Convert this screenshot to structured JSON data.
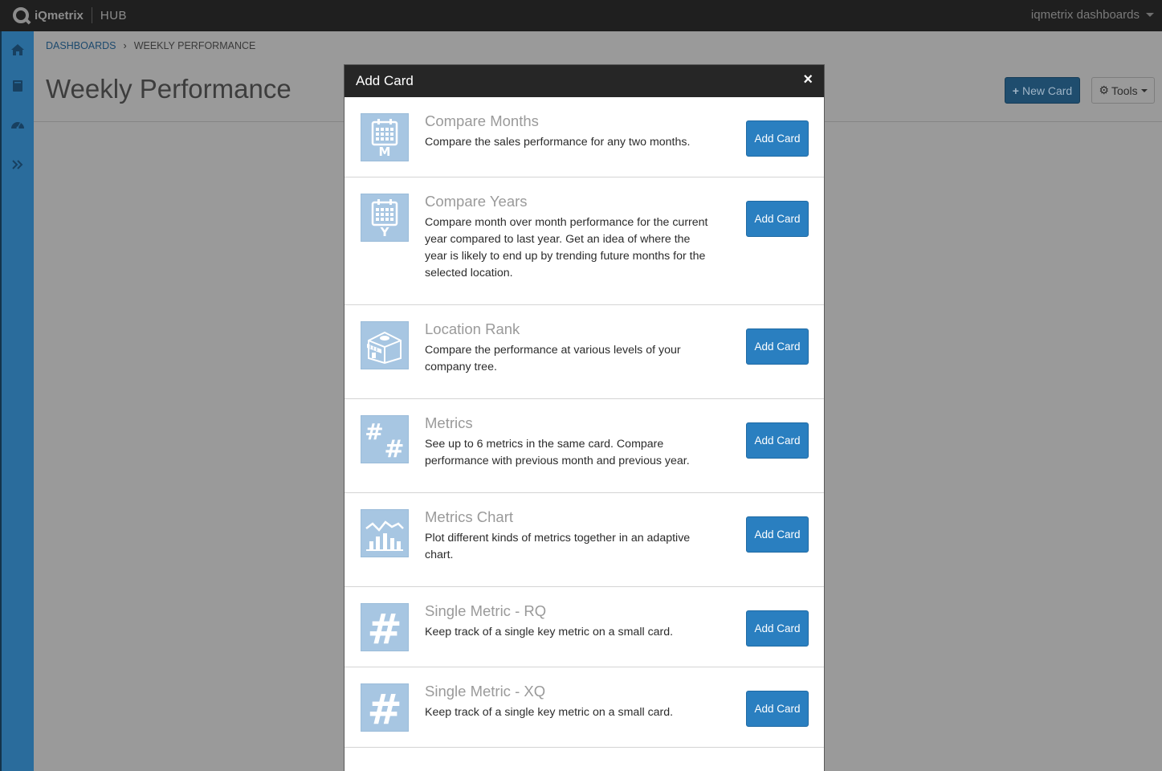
{
  "topbar": {
    "brand": "iQmetrix",
    "app": "HUB",
    "user_menu": "iqmetrix dashboards"
  },
  "sidebar": {
    "items": [
      {
        "icon": "home-icon"
      },
      {
        "icon": "book-icon"
      },
      {
        "icon": "dashboard-gauge-icon"
      },
      {
        "icon": "expand-chevrons-icon"
      }
    ]
  },
  "breadcrumb": {
    "parent": "DASHBOARDS",
    "current": "WEEKLY PERFORMANCE"
  },
  "page": {
    "title": "Weekly Performance",
    "new_card_label": "New Card",
    "tools_label": "Tools"
  },
  "modal": {
    "title": "Add Card",
    "close": "×",
    "cards": [
      {
        "name": "Compare Months",
        "description": "Compare the sales performance for any two months.",
        "button": "Add Card",
        "icon": "calendar-m-icon"
      },
      {
        "name": "Compare Years",
        "description": "Compare month over month performance for the current year compared to last year. Get an idea of where the year is likely to end up by trending future months for the selected location.",
        "button": "Add Card",
        "icon": "calendar-y-icon"
      },
      {
        "name": "Location Rank",
        "description": "Compare the performance at various levels of your company tree.",
        "button": "Add Card",
        "icon": "store-icon"
      },
      {
        "name": "Metrics",
        "description": "See up to 6 metrics in the same card. Compare performance with previous month and previous year.",
        "button": "Add Card",
        "icon": "double-hash-icon"
      },
      {
        "name": "Metrics Chart",
        "description": "Plot different kinds of metrics together in an adaptive chart.",
        "button": "Add Card",
        "icon": "bar-line-chart-icon"
      },
      {
        "name": "Single Metric - RQ",
        "description": "Keep track of a single key metric on a small card.",
        "button": "Add Card",
        "icon": "hash-icon"
      },
      {
        "name": "Single Metric - XQ",
        "description": "Keep track of a single key metric on a small card.",
        "button": "Add Card",
        "icon": "hash-icon"
      }
    ]
  },
  "colors": {
    "topbar": "#1f1f1f",
    "sidebar": "#2a6c9c",
    "primary_button": "#2a7fc0",
    "icon_tile": "#a7c6e2",
    "overlay_content": "#9a9a9a"
  }
}
